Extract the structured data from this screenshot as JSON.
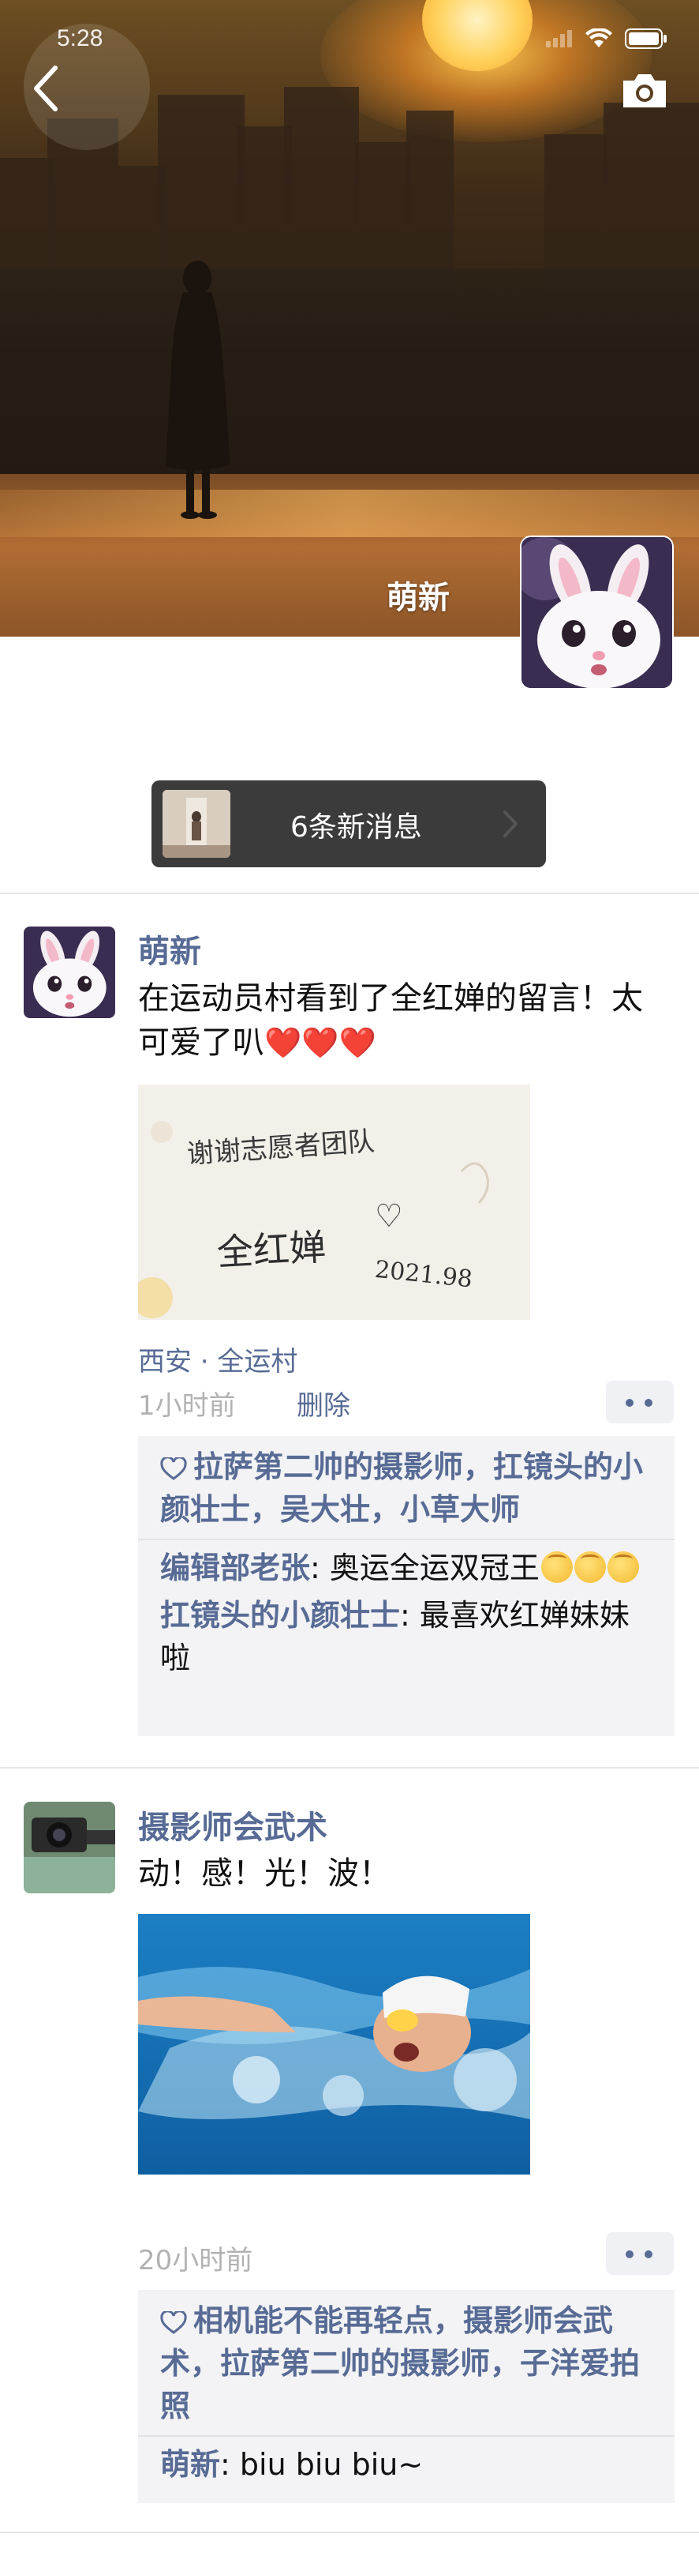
{
  "status_bar": {
    "time": "5:28"
  },
  "cover": {
    "profile_name": "萌新"
  },
  "new_messages": {
    "label": "6条新消息"
  },
  "posts": [
    {
      "author": "萌新",
      "text": "在运动员村看到了全红婵的留言！太可爱了叭",
      "text_emoji": "❤️❤️❤️",
      "photo": {
        "line1": "谢谢志愿者团队",
        "signature": "全红婵",
        "date": "2021.98",
        "heart": "♡"
      },
      "location": "西安 · 全运村",
      "time": "1小时前",
      "delete_label": "删除",
      "likes": "拉萨第二帅的摄影师，扛镜头的小颜壮士，吴大壮，小草大师",
      "comments": [
        {
          "name": "编辑部老张",
          "sep": ": ",
          "text": "奥运全运双冠王",
          "emoji_count": 3
        },
        {
          "name": "扛镜头的小颜壮士",
          "sep": ": ",
          "text": "最喜欢红婵妹妹啦"
        }
      ]
    },
    {
      "author": "摄影师会武术",
      "text": "动！感！光！波！",
      "time": "20小时前",
      "likes": "相机能不能再轻点，摄影师会武术，拉萨第二帅的摄影师，子洋爱拍照",
      "comments": [
        {
          "name": "萌新",
          "sep": ": ",
          "text": "biu biu biu~"
        }
      ]
    }
  ],
  "colors": {
    "link": "#576b95",
    "time": "#b2b2b2",
    "panel": "#f3f3f5"
  }
}
